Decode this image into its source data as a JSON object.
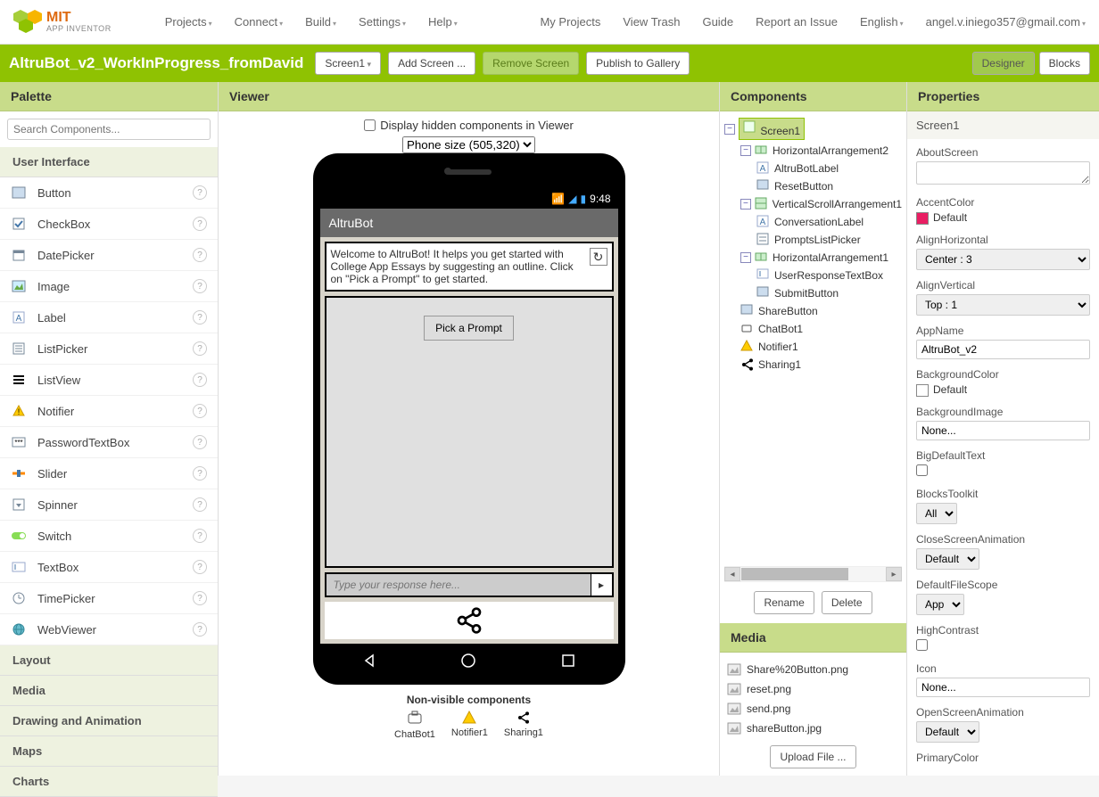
{
  "logo": {
    "mit": "MIT",
    "sub": "APP INVENTOR"
  },
  "menu": {
    "left": [
      "Projects",
      "Connect",
      "Build",
      "Settings",
      "Help"
    ],
    "right": [
      "My Projects",
      "View Trash",
      "Guide",
      "Report an Issue",
      "English",
      "angel.v.iniego357@gmail.com"
    ]
  },
  "project_name": "AltruBot_v2_WorkInProgress_fromDavid",
  "greenbar": {
    "screen": "Screen1",
    "add_screen": "Add Screen ...",
    "remove_screen": "Remove Screen",
    "publish": "Publish to Gallery",
    "designer": "Designer",
    "blocks": "Blocks"
  },
  "palette": {
    "title": "Palette",
    "search_placeholder": "Search Components...",
    "categories": [
      "User Interface",
      "Layout",
      "Media",
      "Drawing and Animation",
      "Maps",
      "Charts"
    ],
    "user_interface": [
      "Button",
      "CheckBox",
      "DatePicker",
      "Image",
      "Label",
      "ListPicker",
      "ListView",
      "Notifier",
      "PasswordTextBox",
      "Slider",
      "Spinner",
      "Switch",
      "TextBox",
      "TimePicker",
      "WebViewer"
    ]
  },
  "viewer": {
    "title": "Viewer",
    "hidden_label": "Display hidden components in Viewer",
    "phone_size": "Phone size (505,320)",
    "status_time": "9:48",
    "app_title": "AltruBot",
    "welcome": "Welcome to AltruBot! It helps you get started with College App Essays by suggesting an outline. Click on \"Pick a Prompt\" to get started.",
    "pick_prompt": "Pick a Prompt",
    "type_placeholder": "Type your response here...",
    "nonvisible_title": "Non-visible components",
    "nonvisible": [
      "ChatBot1",
      "Notifier1",
      "Sharing1"
    ]
  },
  "components": {
    "title": "Components",
    "tree": {
      "root": "Screen1",
      "ha2": "HorizontalArrangement2",
      "altrulabel": "AltruBotLabel",
      "reset": "ResetButton",
      "vsa": "VerticalScrollArrangement1",
      "convlabel": "ConversationLabel",
      "promptslist": "PromptsListPicker",
      "ha1": "HorizontalArrangement1",
      "urtb": "UserResponseTextBox",
      "submit": "SubmitButton",
      "sharebtn": "ShareButton",
      "chatbot": "ChatBot1",
      "notifier": "Notifier1",
      "sharing": "Sharing1"
    },
    "rename": "Rename",
    "delete": "Delete",
    "media_title": "Media",
    "media": [
      "Share%20Button.png",
      "reset.png",
      "send.png",
      "shareButton.jpg"
    ],
    "upload": "Upload File ..."
  },
  "properties": {
    "title": "Properties",
    "subtitle": "Screen1",
    "about_screen": "AboutScreen",
    "accent_color": "AccentColor",
    "accent_default": "Default",
    "align_h": "AlignHorizontal",
    "align_h_val": "Center : 3",
    "align_v": "AlignVertical",
    "align_v_val": "Top : 1",
    "app_name": "AppName",
    "app_name_val": "AltruBot_v2",
    "bg_color": "BackgroundColor",
    "bg_default": "Default",
    "bg_image": "BackgroundImage",
    "none": "None...",
    "big_text": "BigDefaultText",
    "blocks_toolkit": "BlocksToolkit",
    "all": "All",
    "close_anim": "CloseScreenAnimation",
    "default": "Default",
    "file_scope": "DefaultFileScope",
    "app": "App",
    "high_contrast": "HighContrast",
    "icon": "Icon",
    "open_anim": "OpenScreenAnimation",
    "primary_color": "PrimaryColor"
  }
}
